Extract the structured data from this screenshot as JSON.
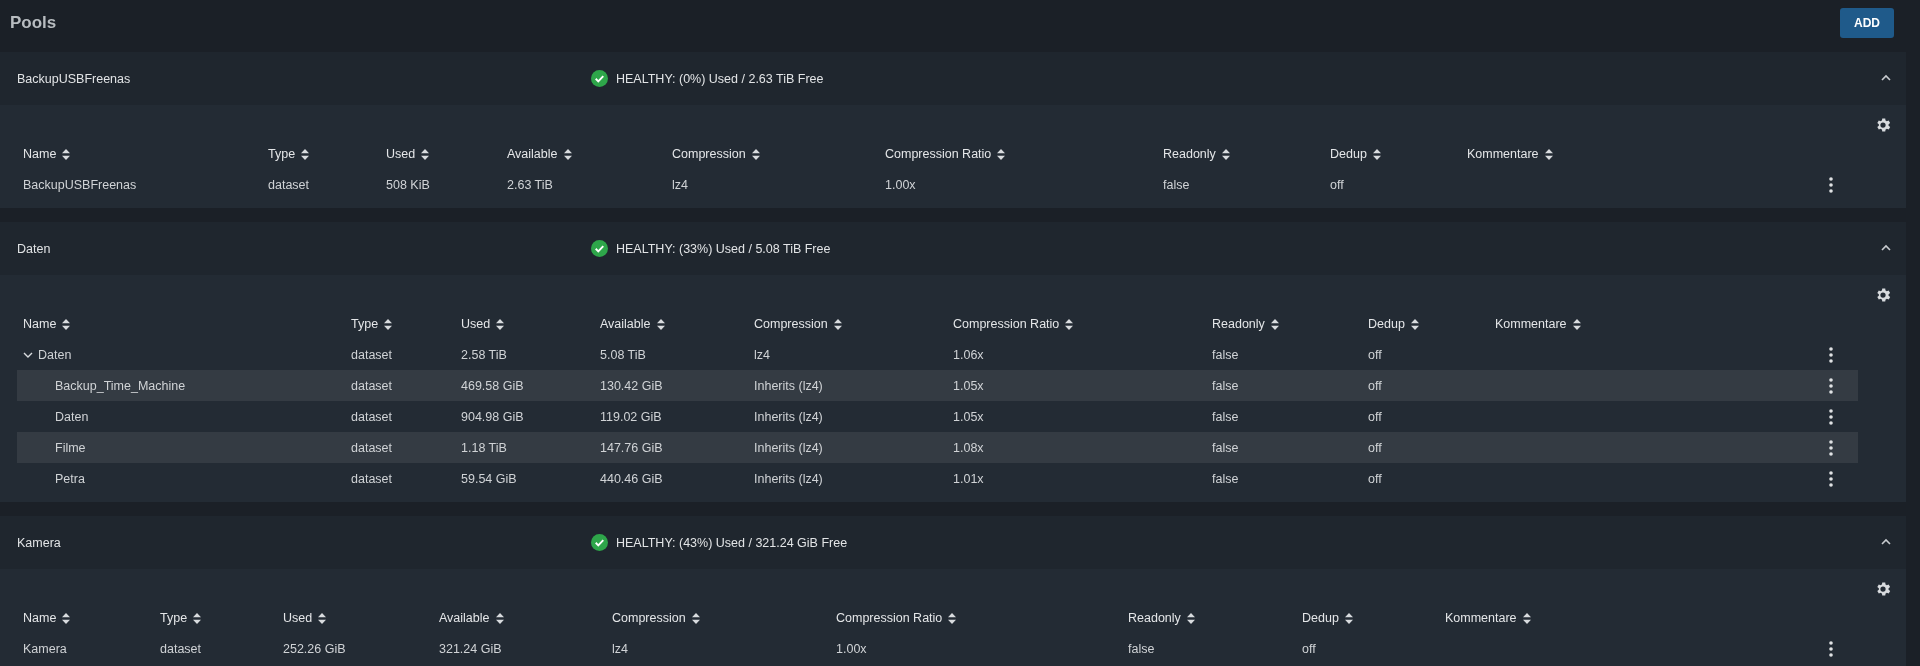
{
  "page": {
    "title": "Pools",
    "add_button": "ADD"
  },
  "pools": [
    {
      "name": "BackupUSBFreenas",
      "healthy": true,
      "status": "HEALTHY: (0%) Used / 2.63 TiB Free",
      "expanded": true,
      "columns": [
        "Name",
        "Type",
        "Used",
        "Available",
        "Compression",
        "Compression Ratio",
        "Readonly",
        "Dedup",
        "Kommentare"
      ],
      "rows": [
        {
          "name": "BackupUSBFreenas",
          "type": "dataset",
          "used": "508 KiB",
          "available": "2.63 TiB",
          "compression": "lz4",
          "compression_ratio": "1.00x",
          "readonly": "false",
          "dedup": "off"
        }
      ]
    },
    {
      "name": "Daten",
      "healthy": true,
      "status": "HEALTHY: (33%) Used / 5.08 TiB Free",
      "expanded": true,
      "columns": [
        "Name",
        "Type",
        "Used",
        "Available",
        "Compression",
        "Compression Ratio",
        "Readonly",
        "Dedup",
        "Kommentare"
      ],
      "rows": [
        {
          "name": "Daten",
          "type": "dataset",
          "used": "2.58 TiB",
          "available": "5.08 TiB",
          "compression": "lz4",
          "compression_ratio": "1.06x",
          "readonly": "false",
          "dedup": "off",
          "expanded": true,
          "children": [
            {
              "name": "Backup_Time_Machine",
              "type": "dataset",
              "used": "469.58 GiB",
              "available": "130.42 GiB",
              "compression": "Inherits (lz4)",
              "compression_ratio": "1.05x",
              "readonly": "false",
              "dedup": "off"
            },
            {
              "name": "Daten",
              "type": "dataset",
              "used": "904.98 GiB",
              "available": "119.02 GiB",
              "compression": "Inherits (lz4)",
              "compression_ratio": "1.05x",
              "readonly": "false",
              "dedup": "off"
            },
            {
              "name": "Filme",
              "type": "dataset",
              "used": "1.18 TiB",
              "available": "147.76 GiB",
              "compression": "Inherits (lz4)",
              "compression_ratio": "1.08x",
              "readonly": "false",
              "dedup": "off"
            },
            {
              "name": "Petra",
              "type": "dataset",
              "used": "59.54 GiB",
              "available": "440.46 GiB",
              "compression": "Inherits (lz4)",
              "compression_ratio": "1.01x",
              "readonly": "false",
              "dedup": "off"
            }
          ]
        }
      ]
    },
    {
      "name": "Kamera",
      "healthy": true,
      "status": "HEALTHY: (43%) Used / 321.24 GiB Free",
      "expanded": true,
      "columns": [
        "Name",
        "Type",
        "Used",
        "Available",
        "Compression",
        "Compression Ratio",
        "Readonly",
        "Dedup",
        "Kommentare"
      ],
      "rows": [
        {
          "name": "Kamera",
          "type": "dataset",
          "used": "252.26 GiB",
          "available": "321.24 GiB",
          "compression": "lz4",
          "compression_ratio": "1.00x",
          "readonly": "false",
          "dedup": "off"
        }
      ]
    }
  ]
}
